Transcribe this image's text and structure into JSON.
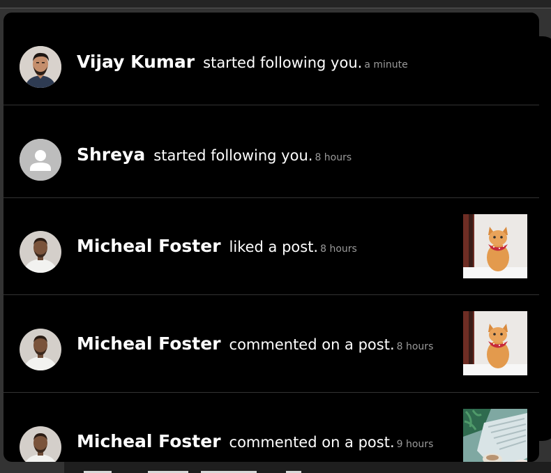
{
  "notifications": [
    {
      "name": "Vijay Kumar",
      "action": "started following you.",
      "time": "a minute",
      "avatar": "photo-avatar-man-beard-icon",
      "has_thumbnail": false
    },
    {
      "name": "Shreya",
      "action": "started following you.",
      "time": "8 hours",
      "avatar": "default-user-avatar-icon",
      "has_thumbnail": false
    },
    {
      "name": "Micheal Foster",
      "action": "liked a post.",
      "time": "8 hours",
      "avatar": "photo-avatar-man-white-shirt-icon",
      "has_thumbnail": true,
      "thumbnail": "cat-with-red-bandana-image"
    },
    {
      "name": "Micheal Foster",
      "action": "commented on a post.",
      "time": "8 hours",
      "avatar": "photo-avatar-man-white-shirt-icon",
      "has_thumbnail": true,
      "thumbnail": "cat-with-red-bandana-image"
    },
    {
      "name": "Micheal Foster",
      "action": "commented on a post.",
      "time": "9 hours",
      "avatar": "photo-avatar-man-white-shirt-icon",
      "has_thumbnail": true,
      "thumbnail": "laptop-desk-plant-image"
    }
  ],
  "colors": {
    "panel_bg": "#000000",
    "name_text": "#ffffff",
    "action_text": "#ffffff",
    "time_text": "#9a9a9a",
    "divider": "#333333",
    "default_avatar_bg": "#bdbdbd"
  }
}
